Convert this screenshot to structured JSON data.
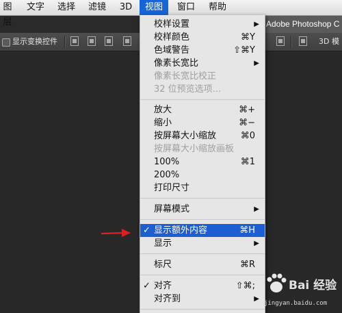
{
  "menubar": {
    "items": [
      {
        "label": "图层"
      },
      {
        "label": "文字"
      },
      {
        "label": "选择"
      },
      {
        "label": "滤镜"
      },
      {
        "label": "3D"
      },
      {
        "label": "视图"
      },
      {
        "label": "窗口"
      },
      {
        "label": "帮助"
      }
    ],
    "active_index": 5
  },
  "title_strip": {
    "text": "Adobe Photoshop C"
  },
  "options_bar": {
    "checkbox_label": "显示变换控件",
    "right_label": "3D 模"
  },
  "view_menu": {
    "items": [
      {
        "label": "校样设置",
        "shortcut": "",
        "submenu": true,
        "disabled": false,
        "checked": false
      },
      {
        "label": "校样颜色",
        "shortcut": "⌘Y",
        "submenu": false,
        "disabled": false,
        "checked": false
      },
      {
        "label": "色域警告",
        "shortcut": "⇧⌘Y",
        "submenu": false,
        "disabled": false,
        "checked": false
      },
      {
        "label": "像素长宽比",
        "shortcut": "",
        "submenu": true,
        "disabled": false,
        "checked": false
      },
      {
        "label": "像素长宽比校正",
        "shortcut": "",
        "submenu": false,
        "disabled": true,
        "checked": false
      },
      {
        "label": "32 位预览选项...",
        "shortcut": "",
        "submenu": false,
        "disabled": true,
        "checked": false
      },
      {
        "label": "放大",
        "shortcut": "⌘+",
        "submenu": false,
        "disabled": false,
        "checked": false
      },
      {
        "label": "缩小",
        "shortcut": "⌘−",
        "submenu": false,
        "disabled": false,
        "checked": false
      },
      {
        "label": "按屏幕大小缩放",
        "shortcut": "⌘0",
        "submenu": false,
        "disabled": false,
        "checked": false
      },
      {
        "label": "按屏幕大小缩放画板",
        "shortcut": "",
        "submenu": false,
        "disabled": true,
        "checked": false
      },
      {
        "label": "100%",
        "shortcut": "⌘1",
        "submenu": false,
        "disabled": false,
        "checked": false
      },
      {
        "label": "200%",
        "shortcut": "",
        "submenu": false,
        "disabled": false,
        "checked": false
      },
      {
        "label": "打印尺寸",
        "shortcut": "",
        "submenu": false,
        "disabled": false,
        "checked": false
      },
      {
        "label": "屏幕模式",
        "shortcut": "",
        "submenu": true,
        "disabled": false,
        "checked": false
      },
      {
        "label": "显示额外内容",
        "shortcut": "⌘H",
        "submenu": false,
        "disabled": false,
        "checked": true,
        "highlighted": true
      },
      {
        "label": "显示",
        "shortcut": "",
        "submenu": true,
        "disabled": false,
        "checked": false
      },
      {
        "label": "标尺",
        "shortcut": "⌘R",
        "submenu": false,
        "disabled": false,
        "checked": false
      },
      {
        "label": "对齐",
        "shortcut": "⇧⌘;",
        "submenu": false,
        "disabled": false,
        "checked": true
      },
      {
        "label": "对齐到",
        "shortcut": "",
        "submenu": true,
        "disabled": false,
        "checked": false
      }
    ]
  },
  "watermark": {
    "brand": "Bai 经验",
    "url": "jingyan.baidu.com"
  },
  "colors": {
    "menu_highlight": "#1d5fd0",
    "arrow": "#e02020"
  }
}
